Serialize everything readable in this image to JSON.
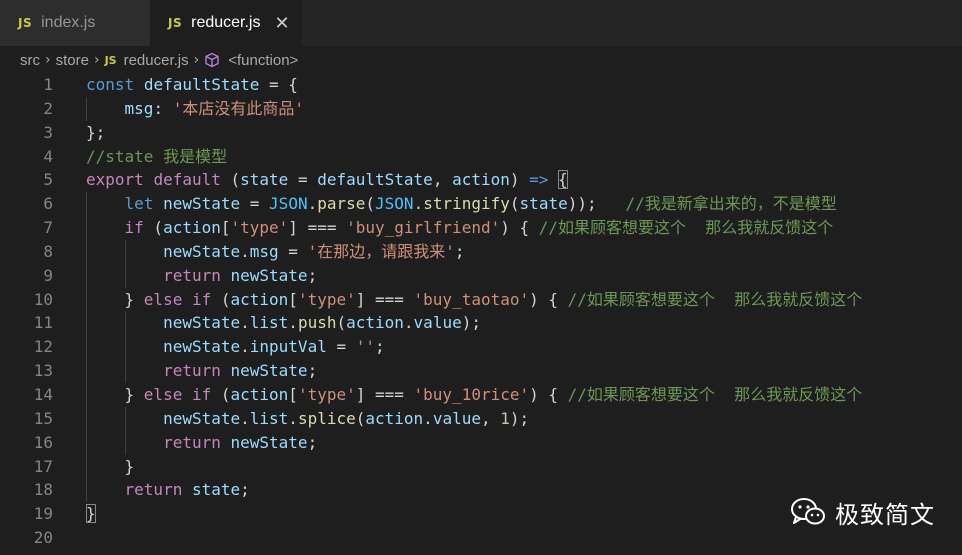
{
  "tabs": [
    {
      "icon": "JS",
      "label": "index.js",
      "active": false
    },
    {
      "icon": "JS",
      "label": "reducer.js",
      "active": true,
      "close": "✕"
    }
  ],
  "breadcrumb": {
    "items": [
      "src",
      "store",
      "reducer.js",
      "<function>"
    ],
    "file_icon": "JS",
    "symbol_icon": "cube-icon"
  },
  "code": {
    "line_numbers": [
      "1",
      "2",
      "3",
      "4",
      "5",
      "6",
      "7",
      "8",
      "9",
      "10",
      "11",
      "12",
      "13",
      "14",
      "15",
      "16",
      "17",
      "18",
      "19",
      "20"
    ],
    "lines": [
      [
        [
          "kw",
          "const"
        ],
        [
          "pun",
          " "
        ],
        [
          "var",
          "defaultState"
        ],
        [
          "pun",
          " = {"
        ]
      ],
      [
        [
          "pun",
          "    "
        ],
        [
          "var",
          "msg"
        ],
        [
          "pun",
          ": "
        ],
        [
          "str",
          "'本店没有此商品'"
        ]
      ],
      [
        [
          "pun",
          "};"
        ]
      ],
      [
        [
          "cmt",
          "//state 我是模型"
        ]
      ],
      [
        [
          "ctl",
          "export"
        ],
        [
          "pun",
          " "
        ],
        [
          "ctl",
          "default"
        ],
        [
          "pun",
          " ("
        ],
        [
          "var",
          "state"
        ],
        [
          "pun",
          " = "
        ],
        [
          "var",
          "defaultState"
        ],
        [
          "pun",
          ", "
        ],
        [
          "var",
          "action"
        ],
        [
          "pun",
          ") "
        ],
        [
          "kw",
          "=>"
        ],
        [
          "pun",
          " "
        ],
        [
          "bmatch",
          "{"
        ]
      ],
      [
        [
          "pun",
          "    "
        ],
        [
          "kw",
          "let"
        ],
        [
          "pun",
          " "
        ],
        [
          "var",
          "newState"
        ],
        [
          "pun",
          " = "
        ],
        [
          "cst",
          "JSON"
        ],
        [
          "pun",
          "."
        ],
        [
          "fn",
          "parse"
        ],
        [
          "pun",
          "("
        ],
        [
          "cst",
          "JSON"
        ],
        [
          "pun",
          "."
        ],
        [
          "fn",
          "stringify"
        ],
        [
          "pun",
          "("
        ],
        [
          "var",
          "state"
        ],
        [
          "pun",
          "));   "
        ],
        [
          "cmt",
          "//我是新拿出来的，不是模型"
        ]
      ],
      [
        [
          "pun",
          "    "
        ],
        [
          "ctl",
          "if"
        ],
        [
          "pun",
          " ("
        ],
        [
          "var",
          "action"
        ],
        [
          "pun",
          "["
        ],
        [
          "str",
          "'type'"
        ],
        [
          "pun",
          "] === "
        ],
        [
          "str",
          "'buy_girlfriend'"
        ],
        [
          "pun",
          ") { "
        ],
        [
          "cmt",
          "//如果顾客想要这个  那么我就反馈这个"
        ]
      ],
      [
        [
          "pun",
          "        "
        ],
        [
          "var",
          "newState"
        ],
        [
          "pun",
          "."
        ],
        [
          "var",
          "msg"
        ],
        [
          "pun",
          " = "
        ],
        [
          "str",
          "'在那边，请跟我来'"
        ],
        [
          "pun",
          ";"
        ]
      ],
      [
        [
          "pun",
          "        "
        ],
        [
          "ctl",
          "return"
        ],
        [
          "pun",
          " "
        ],
        [
          "var",
          "newState"
        ],
        [
          "pun",
          ";"
        ]
      ],
      [
        [
          "pun",
          "    } "
        ],
        [
          "ctl",
          "else"
        ],
        [
          "pun",
          " "
        ],
        [
          "ctl",
          "if"
        ],
        [
          "pun",
          " ("
        ],
        [
          "var",
          "action"
        ],
        [
          "pun",
          "["
        ],
        [
          "str",
          "'type'"
        ],
        [
          "pun",
          "] === "
        ],
        [
          "str",
          "'buy_taotao'"
        ],
        [
          "pun",
          ") { "
        ],
        [
          "cmt",
          "//如果顾客想要这个  那么我就反馈这个"
        ]
      ],
      [
        [
          "pun",
          "        "
        ],
        [
          "var",
          "newState"
        ],
        [
          "pun",
          "."
        ],
        [
          "var",
          "list"
        ],
        [
          "pun",
          "."
        ],
        [
          "fn",
          "push"
        ],
        [
          "pun",
          "("
        ],
        [
          "var",
          "action"
        ],
        [
          "pun",
          "."
        ],
        [
          "var",
          "value"
        ],
        [
          "pun",
          ");"
        ]
      ],
      [
        [
          "pun",
          "        "
        ],
        [
          "var",
          "newState"
        ],
        [
          "pun",
          "."
        ],
        [
          "var",
          "inputVal"
        ],
        [
          "pun",
          " = "
        ],
        [
          "str",
          "''"
        ],
        [
          "pun",
          ";"
        ]
      ],
      [
        [
          "pun",
          "        "
        ],
        [
          "ctl",
          "return"
        ],
        [
          "pun",
          " "
        ],
        [
          "var",
          "newState"
        ],
        [
          "pun",
          ";"
        ]
      ],
      [
        [
          "pun",
          "    } "
        ],
        [
          "ctl",
          "else"
        ],
        [
          "pun",
          " "
        ],
        [
          "ctl",
          "if"
        ],
        [
          "pun",
          " ("
        ],
        [
          "var",
          "action"
        ],
        [
          "pun",
          "["
        ],
        [
          "str",
          "'type'"
        ],
        [
          "pun",
          "] === "
        ],
        [
          "str",
          "'buy_10rice'"
        ],
        [
          "pun",
          ") { "
        ],
        [
          "cmt",
          "//如果顾客想要这个  那么我就反馈这个"
        ]
      ],
      [
        [
          "pun",
          "        "
        ],
        [
          "var",
          "newState"
        ],
        [
          "pun",
          "."
        ],
        [
          "var",
          "list"
        ],
        [
          "pun",
          "."
        ],
        [
          "fn",
          "splice"
        ],
        [
          "pun",
          "("
        ],
        [
          "var",
          "action"
        ],
        [
          "pun",
          "."
        ],
        [
          "var",
          "value"
        ],
        [
          "pun",
          ", "
        ],
        [
          "num",
          "1"
        ],
        [
          "pun",
          ");"
        ]
      ],
      [
        [
          "pun",
          "        "
        ],
        [
          "ctl",
          "return"
        ],
        [
          "pun",
          " "
        ],
        [
          "var",
          "newState"
        ],
        [
          "pun",
          ";"
        ]
      ],
      [
        [
          "pun",
          "    }"
        ]
      ],
      [
        [
          "pun",
          "    "
        ],
        [
          "ctl",
          "return"
        ],
        [
          "pun",
          " "
        ],
        [
          "var",
          "state"
        ],
        [
          "pun",
          ";"
        ]
      ],
      [
        [
          "bmatch",
          "}"
        ]
      ],
      []
    ],
    "indent_guides": [
      0,
      1,
      0,
      0,
      0,
      1,
      1,
      2,
      2,
      1,
      2,
      2,
      2,
      1,
      2,
      2,
      1,
      1,
      0,
      0
    ]
  },
  "watermark": {
    "logo": "wechat-icon",
    "text": "极致简文"
  },
  "colors": {
    "background": "#1e1e1e",
    "keyword": "#569cd6",
    "control": "#c586c0",
    "variable": "#9cdcfe",
    "constant": "#4fc1ff",
    "function": "#dcdcaa",
    "string": "#ce9178",
    "number": "#b5cea8",
    "comment": "#6a9955",
    "js_icon": "#cbcb41"
  }
}
